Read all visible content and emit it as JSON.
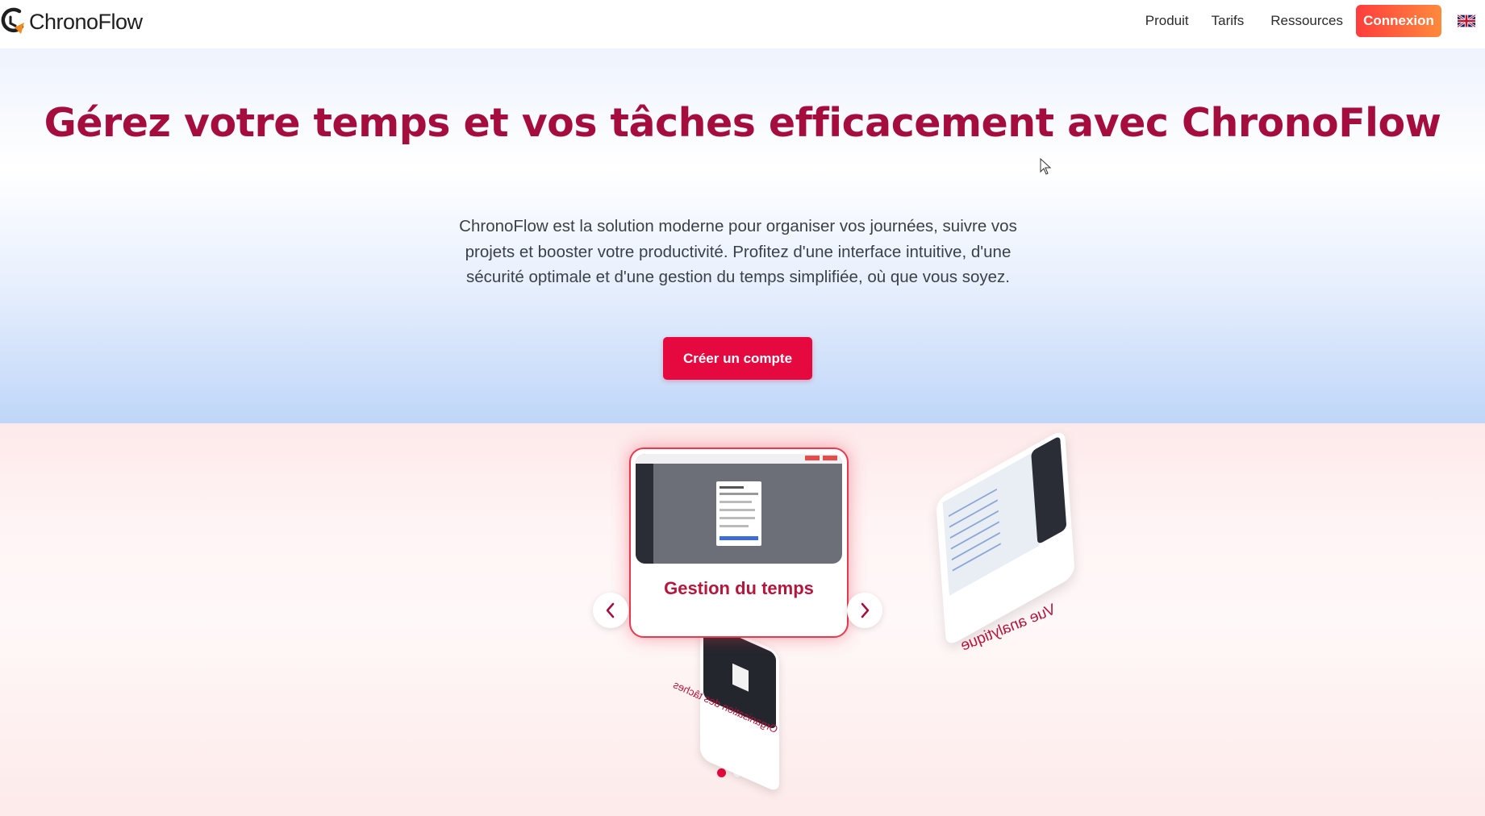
{
  "header": {
    "brand": "ChronoFlow",
    "nav": {
      "produit": "Produit",
      "tarifs": "Tarifs",
      "ressources": "Ressources"
    },
    "login_label": "Connexion",
    "language_icon": "uk-flag-icon"
  },
  "hero": {
    "title": "Gérez votre temps et vos tâches efficacement avec ChronoFlow",
    "description": "ChronoFlow est la solution moderne pour organiser vos journées, suivre vos projets et booster votre productivité. Profitez d'une interface intuitive, d'une sécurité optimale et d'une gestion du temps simplifiée, où que vous soyez.",
    "cta_label": "Créer un compte"
  },
  "carousel": {
    "slides": [
      {
        "label": "Gestion du temps"
      },
      {
        "label": "Organisation des tâches"
      },
      {
        "label": "Vue analytique"
      }
    ],
    "active_index": 0,
    "prev_icon": "chevron-left-icon",
    "next_icon": "chevron-right-icon"
  },
  "colors": {
    "brand_primary": "#e6093f",
    "title_color": "#a40d3e",
    "login_gradient_start": "#ff3d3d",
    "login_gradient_end": "#ff8a3d"
  }
}
